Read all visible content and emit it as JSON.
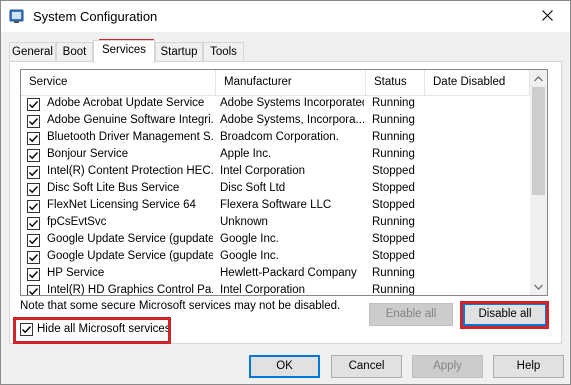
{
  "window": {
    "title": "System Configuration",
    "icon": "msconfig-icon",
    "close_glyph": "✕"
  },
  "tabs": [
    {
      "label": "General",
      "active": false
    },
    {
      "label": "Boot",
      "active": false
    },
    {
      "label": "Services",
      "active": true
    },
    {
      "label": "Startup",
      "active": false
    },
    {
      "label": "Tools",
      "active": false
    }
  ],
  "services_list": {
    "columns": [
      "Service",
      "Manufacturer",
      "Status",
      "Date Disabled"
    ],
    "rows": [
      {
        "service": "Adobe Acrobat Update Service",
        "manufacturer": "Adobe Systems Incorporated",
        "status": "Running",
        "date_disabled": "",
        "checked": true
      },
      {
        "service": "Adobe Genuine Software Integri...",
        "manufacturer": "Adobe Systems, Incorpora...",
        "status": "Running",
        "date_disabled": "",
        "checked": true
      },
      {
        "service": "Bluetooth Driver Management S...",
        "manufacturer": "Broadcom Corporation.",
        "status": "Running",
        "date_disabled": "",
        "checked": true
      },
      {
        "service": "Bonjour Service",
        "manufacturer": "Apple Inc.",
        "status": "Running",
        "date_disabled": "",
        "checked": true
      },
      {
        "service": "Intel(R) Content Protection HEC...",
        "manufacturer": "Intel Corporation",
        "status": "Stopped",
        "date_disabled": "",
        "checked": true
      },
      {
        "service": "Disc Soft Lite Bus Service",
        "manufacturer": "Disc Soft Ltd",
        "status": "Stopped",
        "date_disabled": "",
        "checked": true
      },
      {
        "service": "FlexNet Licensing Service 64",
        "manufacturer": "Flexera Software LLC",
        "status": "Stopped",
        "date_disabled": "",
        "checked": true
      },
      {
        "service": "fpCsEvtSvc",
        "manufacturer": "Unknown",
        "status": "Running",
        "date_disabled": "",
        "checked": true
      },
      {
        "service": "Google Update Service (gupdate)",
        "manufacturer": "Google Inc.",
        "status": "Stopped",
        "date_disabled": "",
        "checked": true
      },
      {
        "service": "Google Update Service (gupdatem)",
        "manufacturer": "Google Inc.",
        "status": "Stopped",
        "date_disabled": "",
        "checked": true
      },
      {
        "service": "HP Service",
        "manufacturer": "Hewlett-Packard Company",
        "status": "Running",
        "date_disabled": "",
        "checked": true
      },
      {
        "service": "Intel(R) HD Graphics Control Pa...",
        "manufacturer": "Intel Corporation",
        "status": "Running",
        "date_disabled": "",
        "checked": true
      }
    ]
  },
  "note": "Note that some secure Microsoft services may not be disabled.",
  "buttons": {
    "enable_all": "Enable all",
    "disable_all": "Disable all",
    "ok": "OK",
    "cancel": "Cancel",
    "apply": "Apply",
    "help": "Help"
  },
  "hide_microsoft": {
    "label": "Hide all Microsoft services",
    "checked": true
  },
  "colors": {
    "highlight_red": "#d2232a",
    "focus_blue": "#0078d7"
  }
}
